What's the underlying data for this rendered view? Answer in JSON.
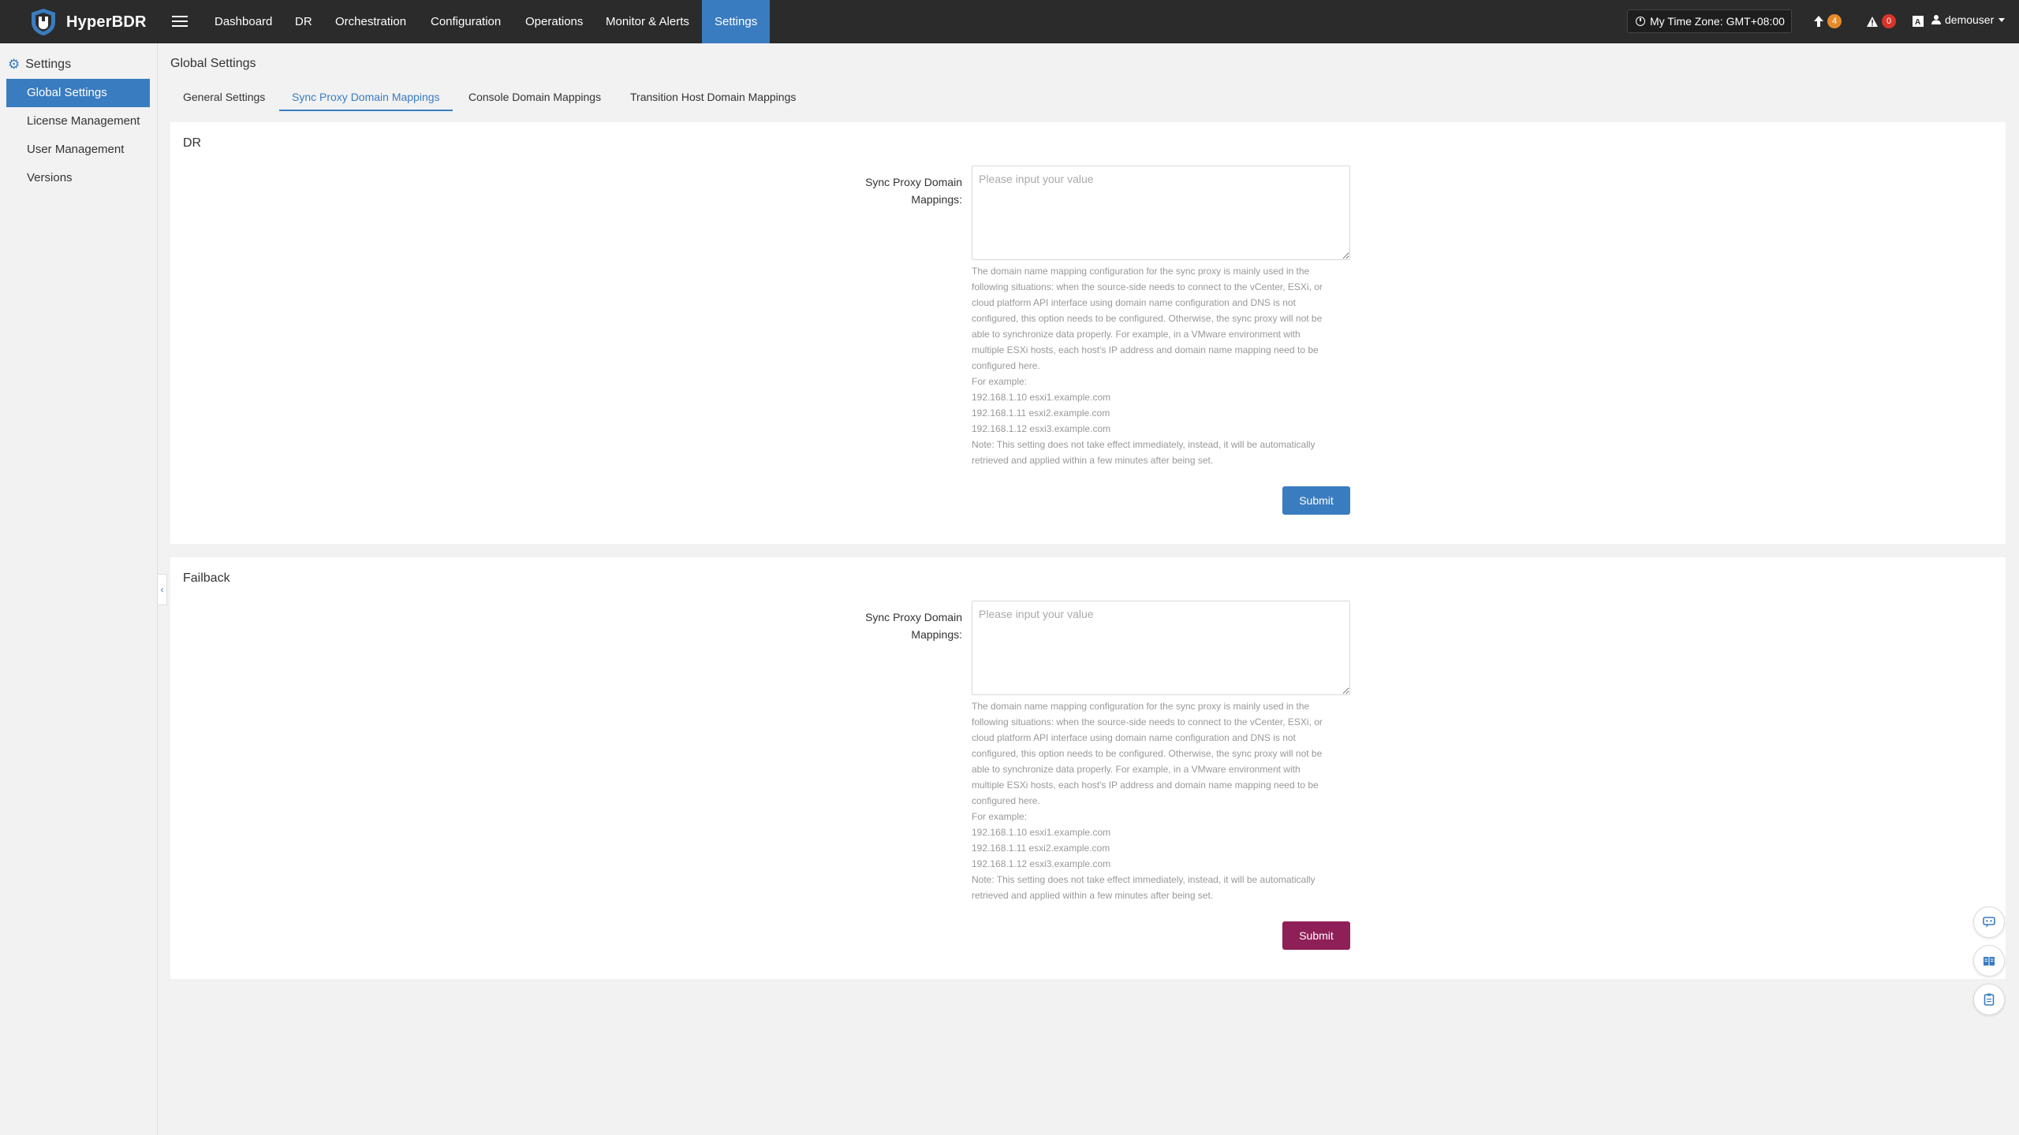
{
  "app": {
    "name": "HyperBDR"
  },
  "nav": {
    "items": [
      "Dashboard",
      "DR",
      "Orchestration",
      "Configuration",
      "Operations",
      "Monitor & Alerts",
      "Settings"
    ],
    "active": "Settings"
  },
  "header": {
    "timezone_label": "My Time Zone:",
    "timezone_value": "GMT+08:00",
    "upgrade_count": "4",
    "alert_count": "0",
    "username": "demouser"
  },
  "sidebar": {
    "title": "Settings",
    "items": [
      "Global Settings",
      "License Management",
      "User Management",
      "Versions"
    ],
    "active": "Global Settings"
  },
  "main": {
    "page_title": "Global Settings",
    "tabs": [
      "General Settings",
      "Sync Proxy Domain Mappings",
      "Console Domain Mappings",
      "Transition Host Domain Mappings"
    ],
    "active_tab": "Sync Proxy Domain Mappings",
    "sections": [
      {
        "title": "DR",
        "field_label_line1": "Sync Proxy Domain",
        "field_label_line2": "Mappings:",
        "value": "",
        "placeholder": "Please input your value",
        "help_lines": [
          "The domain name mapping configuration for the sync proxy is mainly used in the",
          "following situations: when the source-side needs to connect to the vCenter, ESXi, or",
          "cloud platform API interface using domain name configuration and DNS is not",
          "configured, this option needs to be configured. Otherwise, the sync proxy will not be",
          "able to synchronize data properly. For example, in a VMware environment with",
          "multiple ESXi hosts, each host's IP address and domain name mapping need to be",
          "configured here.",
          "For example:",
          "192.168.1.10 esxi1.example.com",
          "192.168.1.11 esxi2.example.com",
          "192.168.1.12 esxi3.example.com",
          "Note: This setting does not take effect immediately, instead, it will be automatically",
          "retrieved and applied within a few minutes after being set."
        ],
        "submit_label": "Submit"
      },
      {
        "title": "Failback",
        "field_label_line1": "Sync Proxy Domain",
        "field_label_line2": "Mappings:",
        "value": "",
        "placeholder": "Please input your value",
        "help_lines": [
          "The domain name mapping configuration for the sync proxy is mainly used in the",
          "following situations: when the source-side needs to connect to the vCenter, ESXi, or",
          "cloud platform API interface using domain name configuration and DNS is not",
          "configured, this option needs to be configured. Otherwise, the sync proxy will not be",
          "able to synchronize data properly. For example, in a VMware environment with",
          "multiple ESXi hosts, each host's IP address and domain name mapping need to be",
          "configured here.",
          "For example:",
          "192.168.1.10 esxi1.example.com",
          "192.168.1.11 esxi2.example.com",
          "192.168.1.12 esxi3.example.com",
          "Note: This setting does not take effect immediately, instead, it will be automatically",
          "retrieved and applied within a few minutes after being set."
        ],
        "submit_label": "Submit"
      }
    ]
  },
  "colors": {
    "primary": "#3a7cc0",
    "topbar": "#2b2b2b",
    "submit_failback": "#8f1f57",
    "badge_orange": "#e58a2b",
    "badge_red": "#d9342b"
  },
  "floating_icons": [
    "support-chat-icon",
    "docs-book-icon",
    "clipboard-icon"
  ]
}
